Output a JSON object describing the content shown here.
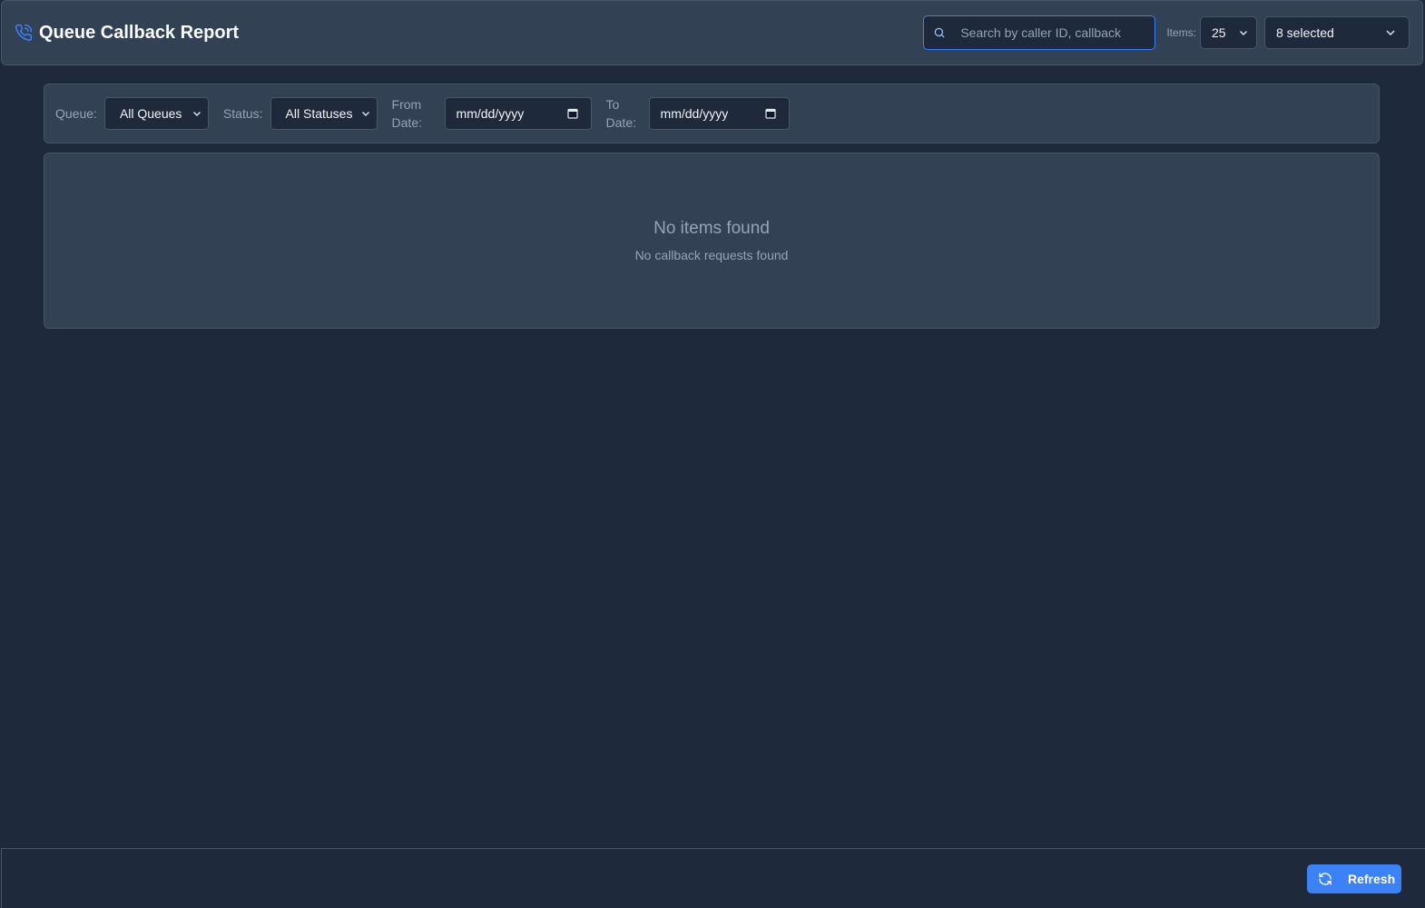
{
  "header": {
    "title": "Queue Callback Report",
    "title_icon": "phone-callback-icon",
    "search_placeholder": "Search by caller ID, callback",
    "items_label": "Items:",
    "items_value": "25",
    "columns_value": "8 selected"
  },
  "filters": {
    "queue_label": "Queue:",
    "queue_value": "All Queues",
    "status_label": "Status:",
    "status_value": "All Statuses",
    "from_label_1": "From",
    "from_label_2": "Date:",
    "from_placeholder": "mm/dd/yyyy",
    "to_label_1": "To",
    "to_label_2": "Date:",
    "to_placeholder": "mm/dd/yyyy"
  },
  "empty": {
    "title": "No items found",
    "subtitle": "No callback requests found"
  },
  "footer": {
    "refresh_label": "Refresh"
  },
  "colors": {
    "background": "#1e293b",
    "panel": "#334155",
    "accent": "#3b82f6"
  }
}
